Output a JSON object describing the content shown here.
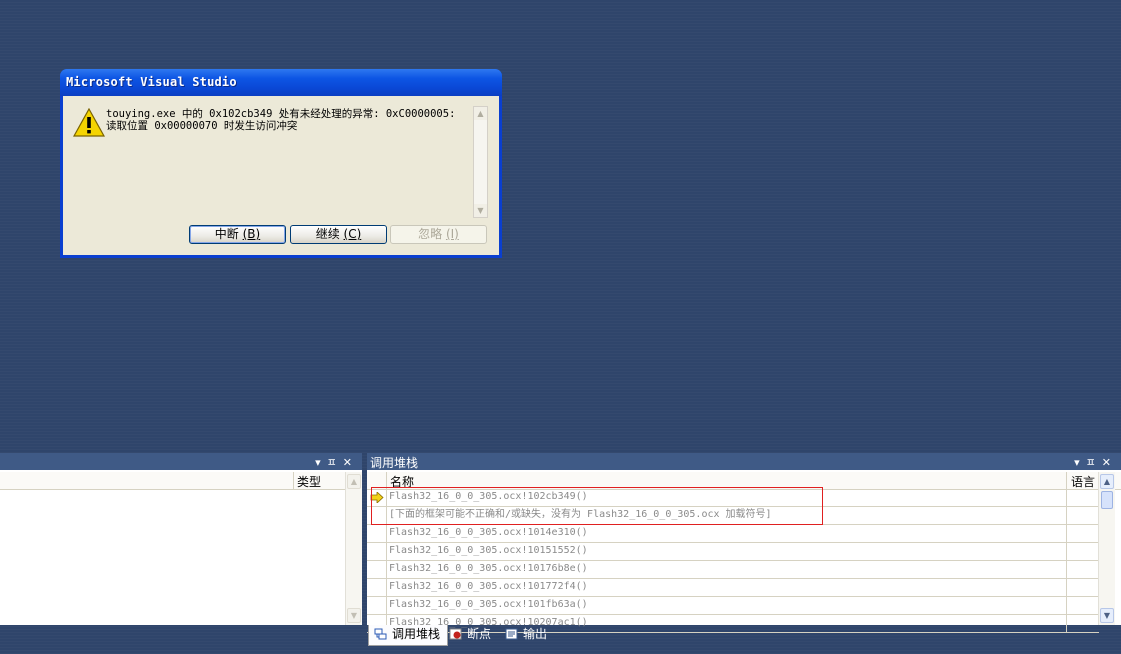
{
  "dialog": {
    "title": "Microsoft Visual Studio",
    "message_line1": "touying.exe 中的 0x102cb349 处有未经处理的异常: 0xC0000005:",
    "message_line2": "读取位置 0x00000070 时发生访问冲突",
    "buttons": {
      "break": {
        "text": "中断 ",
        "key": "(B)"
      },
      "continue": {
        "text": "继续 ",
        "key": "(C)"
      },
      "ignore": {
        "text": "忽略 ",
        "key": "(I)"
      }
    }
  },
  "left_pane": {
    "column_type": "类型"
  },
  "call_stack": {
    "title": "调用堆栈",
    "column_name": "名称",
    "column_language": "语言",
    "rows": [
      {
        "name": "Flash32_16_0_0_305.ocx!102cb349()",
        "current": true
      },
      {
        "name": "[下面的框架可能不正确和/或缺失，没有为 Flash32_16_0_0_305.ocx 加载符号]"
      },
      {
        "name": "Flash32_16_0_0_305.ocx!1014e310()"
      },
      {
        "name": "Flash32_16_0_0_305.ocx!10151552()"
      },
      {
        "name": "Flash32_16_0_0_305.ocx!10176b8e()"
      },
      {
        "name": "Flash32_16_0_0_305.ocx!101772f4()"
      },
      {
        "name": "Flash32_16_0_0_305.ocx!101fb63a()"
      },
      {
        "name": "Flash32_16_0_0_305.ocx!10207ac1()"
      }
    ]
  },
  "pane_icons": {
    "dropdown": "▾",
    "pin": "ㅍ",
    "close": "✕"
  },
  "tabs": [
    {
      "label": "调用堆栈",
      "icon": "call-stack-icon",
      "active": true
    },
    {
      "label": "断点",
      "icon": "breakpoint-icon"
    },
    {
      "label": "输出",
      "icon": "output-icon"
    }
  ]
}
